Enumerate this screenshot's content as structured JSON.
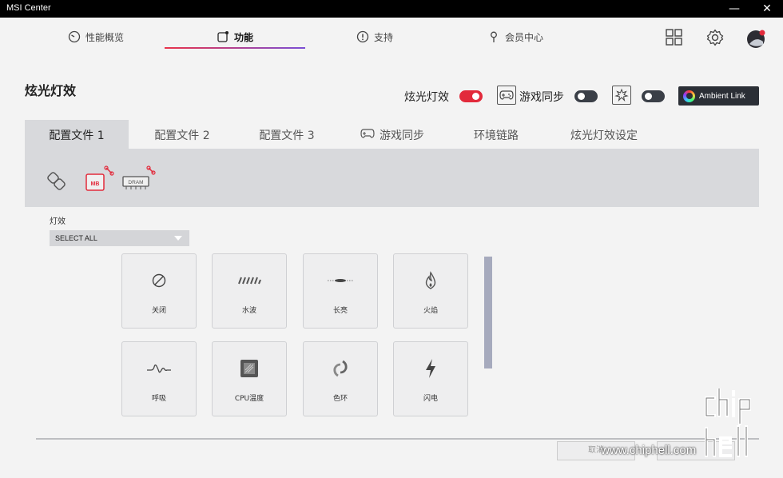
{
  "window": {
    "title": "MSI Center",
    "minimize": "—",
    "close": "✕"
  },
  "nav": {
    "tabs": [
      {
        "label": "性能概览",
        "icon": "gauge-icon"
      },
      {
        "label": "功能",
        "icon": "feature-icon"
      },
      {
        "label": "支持",
        "icon": "support-icon"
      },
      {
        "label": "会员中心",
        "icon": "member-icon"
      }
    ],
    "active_index": 1,
    "right_icons": [
      "grid-icon",
      "gear-icon",
      "avatar"
    ]
  },
  "page": {
    "title": "炫光灯效"
  },
  "header_controls": {
    "mystic_light_label": "炫光灯效",
    "mystic_light_on": true,
    "game_sync_label": "游戏同步",
    "game_sync_on": false,
    "razer_sync_on": false,
    "ambient_link_label": "Ambient Link"
  },
  "profile_tabs": [
    {
      "label": "配置文件 1",
      "active": true
    },
    {
      "label": "配置文件 2",
      "active": false
    },
    {
      "label": "配置文件 3",
      "active": false
    },
    {
      "label": "游戏同步",
      "active": false,
      "icon": "gamepad-icon"
    },
    {
      "label": "环境链路",
      "active": false
    },
    {
      "label": "炫光灯效设定",
      "active": false
    }
  ],
  "devices": [
    {
      "name": "link-icon"
    },
    {
      "name": "mb-icon",
      "text": "MB"
    },
    {
      "name": "dram-icon",
      "text": "DRAM"
    }
  ],
  "effects": {
    "label": "灯效",
    "select_value": "SELECT ALL",
    "items": [
      {
        "label": "关闭",
        "icon": "off-icon"
      },
      {
        "label": "水波",
        "icon": "wave-icon"
      },
      {
        "label": "长亮",
        "icon": "steady-icon"
      },
      {
        "label": "火焰",
        "icon": "flame-icon"
      },
      {
        "label": "呼吸",
        "icon": "breathing-icon"
      },
      {
        "label": "CPU温度",
        "icon": "cpu-temp-icon"
      },
      {
        "label": "色环",
        "icon": "color-ring-icon"
      },
      {
        "label": "闪电",
        "icon": "lightning-icon"
      }
    ]
  },
  "footer": {
    "cancel_label": "取消"
  },
  "watermark": {
    "url": "www.chiphell.com",
    "logo": "chip hell"
  },
  "colors": {
    "accent_red": "#e22a3b",
    "accent_purple": "#7b4fd6",
    "toggle_off": "#3a3f47"
  }
}
